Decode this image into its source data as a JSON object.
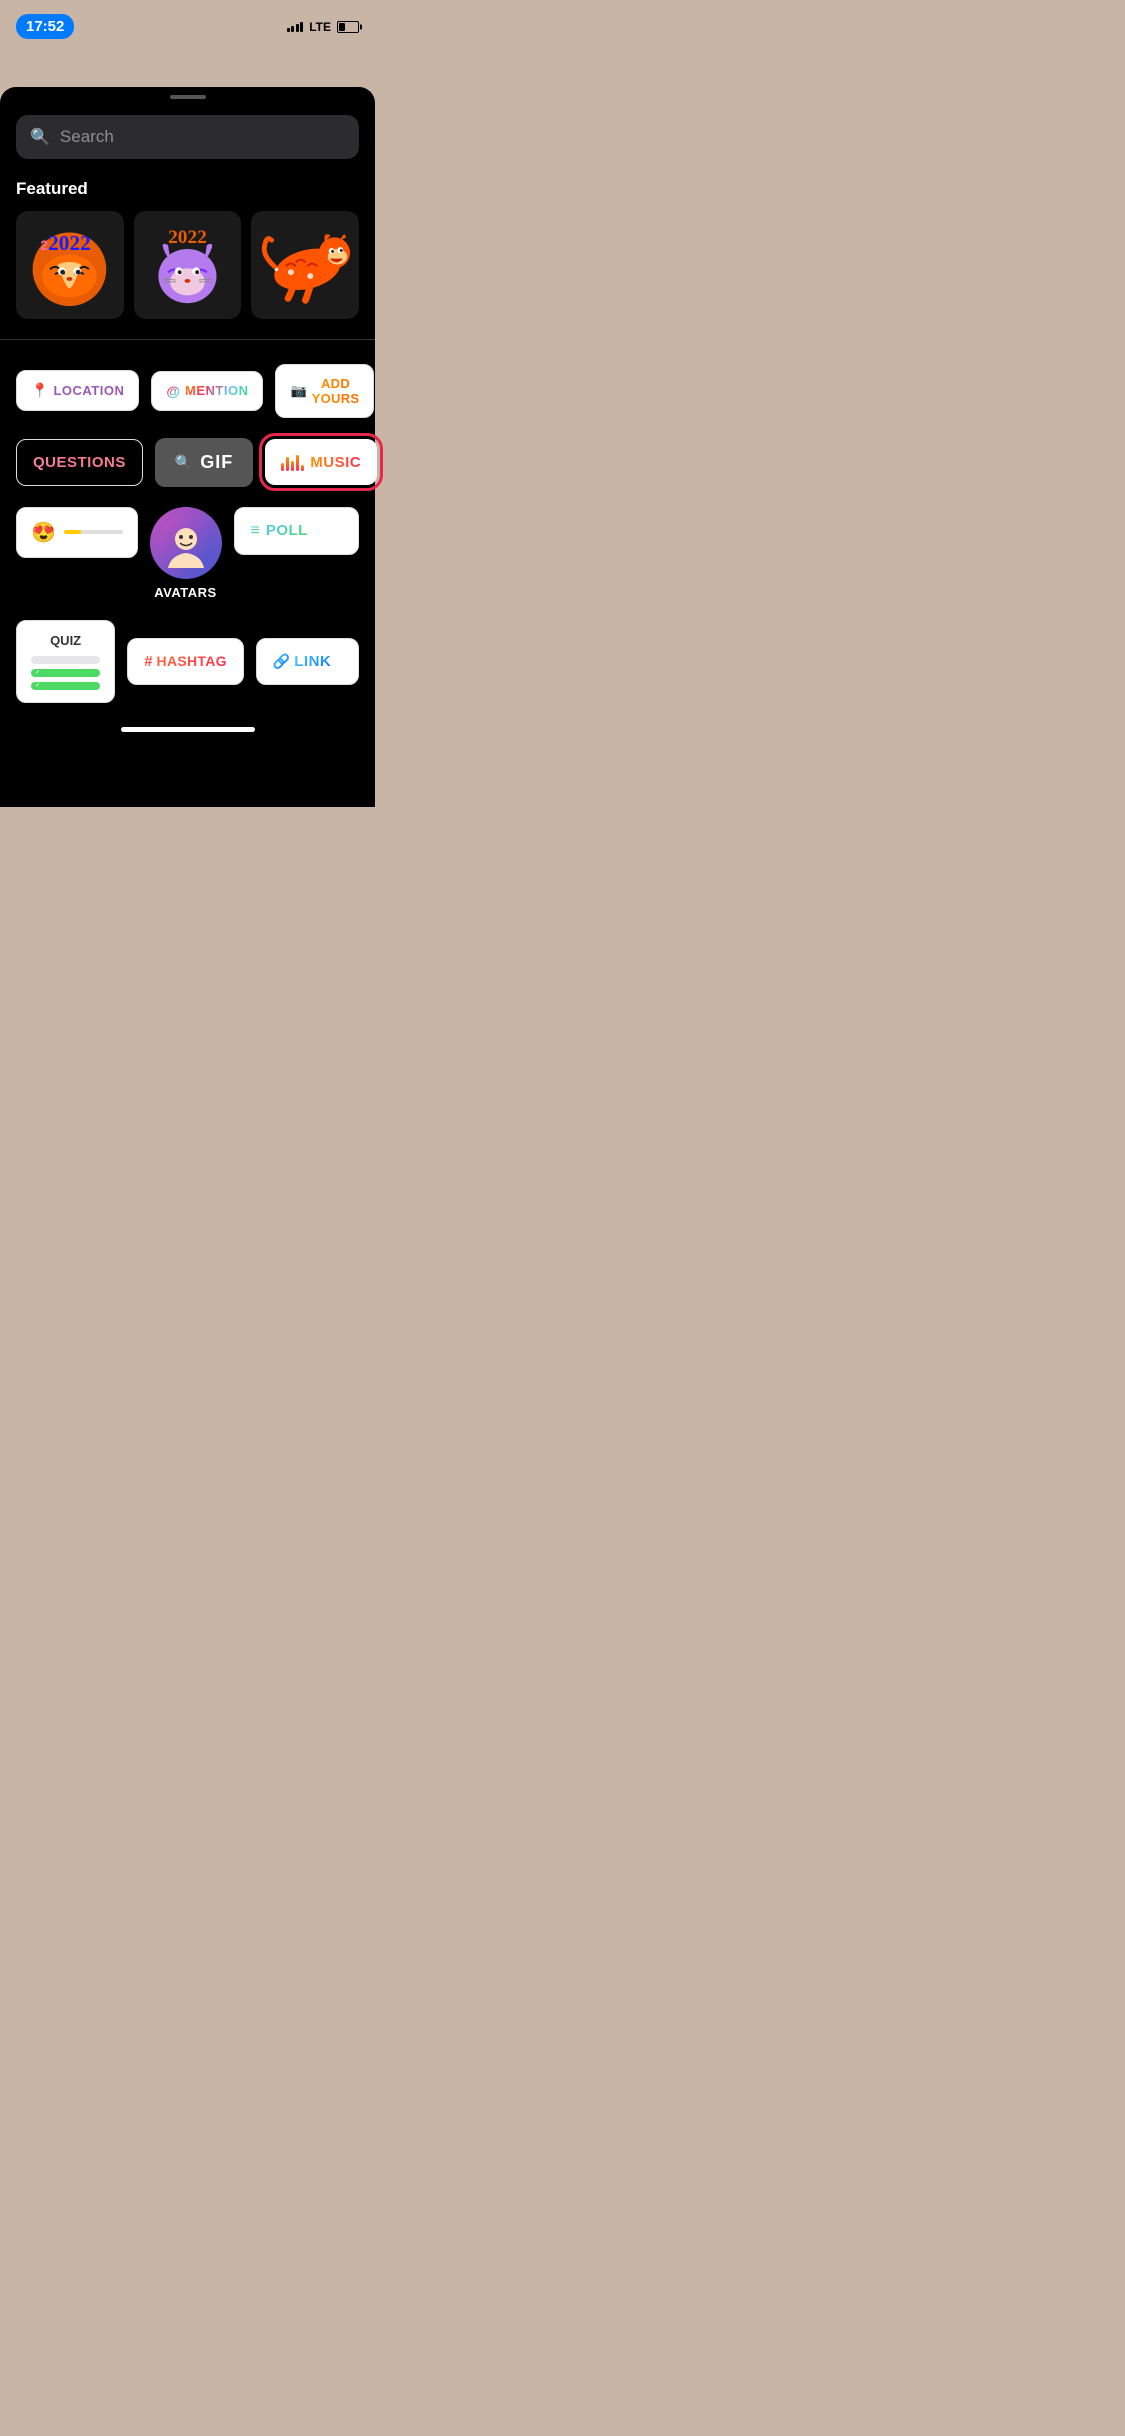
{
  "statusBar": {
    "time": "17:52",
    "carrier": "LTE"
  },
  "search": {
    "placeholder": "Search"
  },
  "featured": {
    "label": "Featured",
    "items": [
      {
        "emoji": "🐯",
        "alt": "tiger-2022-sticker-1"
      },
      {
        "emoji": "🐯",
        "alt": "tiger-2022-sticker-2"
      },
      {
        "emoji": "🐯",
        "alt": "tiger-sticker-3"
      }
    ]
  },
  "stickers": {
    "location": {
      "icon": "📍",
      "label": "LOCATION"
    },
    "mention": {
      "prefix": "@",
      "label": "MENTION"
    },
    "addYours": {
      "icon": "📷",
      "label": "ADD YOURS"
    },
    "questions": {
      "label": "QUESTIONS"
    },
    "gif": {
      "icon": "🔍",
      "label": "GIF"
    },
    "music": {
      "label": "MUSIC"
    },
    "emojiSlider": {
      "emoji": "😍"
    },
    "avatars": {
      "label": "AVATARS"
    },
    "poll": {
      "label": "POLL"
    },
    "quiz": {
      "label": "QUIZ"
    },
    "hashtag": {
      "prefix": "#",
      "label": "HASHTAG"
    },
    "link": {
      "icon": "🔗",
      "label": "LINK"
    }
  }
}
